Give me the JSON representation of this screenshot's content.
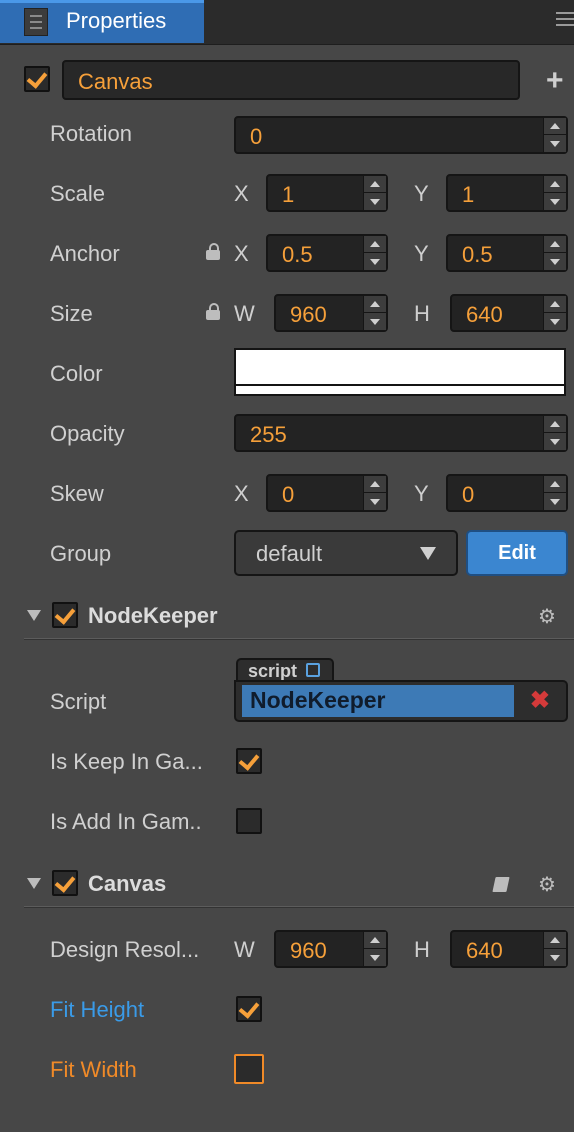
{
  "panel": {
    "title": "Properties"
  },
  "node": {
    "name": "Canvas",
    "active": true,
    "rotation": "0",
    "scale": {
      "x": "1",
      "y": "1"
    },
    "anchor": {
      "x": "0.5",
      "y": "0.5"
    },
    "size": {
      "w": "960",
      "h": "640"
    },
    "color": "#ffffff",
    "opacity": "255",
    "skew": {
      "x": "0",
      "y": "0"
    },
    "group": "default",
    "edit_label": "Edit"
  },
  "labels": {
    "rotation": "Rotation",
    "scale": "Scale",
    "anchor": "Anchor",
    "size": "Size",
    "color": "Color",
    "opacity": "Opacity",
    "skew": "Skew",
    "group": "Group",
    "x": "X",
    "y": "Y",
    "w": "W",
    "h": "H"
  },
  "nodekeeper": {
    "title": "NodeKeeper",
    "enabled": true,
    "script_label": "Script",
    "script_tag": "script",
    "script_value": "NodeKeeper",
    "keep_label": "Is Keep In Ga...",
    "keep_checked": true,
    "add_label": "Is Add In Gam..",
    "add_checked": false
  },
  "canvas_comp": {
    "title": "Canvas",
    "enabled": true,
    "design_label": "Design Resol...",
    "design_w": "960",
    "design_h": "640",
    "fit_height_label": "Fit Height",
    "fit_height": true,
    "fit_width_label": "Fit Width",
    "fit_width": false
  },
  "colors": {
    "accent": "#f6a03a",
    "tab": "#2f6db4",
    "fit_height": "#3a9be8",
    "fit_width": "#f08a28"
  }
}
